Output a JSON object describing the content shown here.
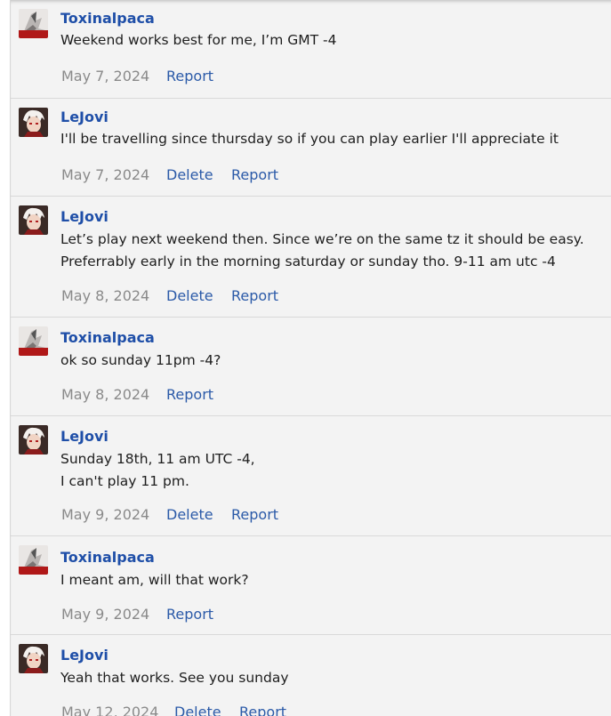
{
  "messages": [
    {
      "author": "Toxinalpaca",
      "avatar": "toxinalpaca-avatar",
      "lines": [
        "Weekend works best for me, I’m GMT -4"
      ],
      "date": "May 7, 2024",
      "actions": [
        "Report"
      ]
    },
    {
      "author": "LeJovi",
      "avatar": "lejovi-avatar",
      "lines": [
        "I'll be travelling since thursday so if you can play earlier I'll appreciate it"
      ],
      "date": "May 7, 2024",
      "actions": [
        "Delete",
        "Report"
      ]
    },
    {
      "author": "LeJovi",
      "avatar": "lejovi-avatar",
      "lines": [
        "Let’s play next weekend then. Since we’re on the same tz it should be easy.",
        "Preferrably early in the morning saturday or sunday tho. 9-11 am utc -4"
      ],
      "date": "May 8, 2024",
      "actions": [
        "Delete",
        "Report"
      ]
    },
    {
      "author": "Toxinalpaca",
      "avatar": "toxinalpaca-avatar",
      "lines": [
        "ok so sunday 11pm -4?"
      ],
      "date": "May 8, 2024",
      "actions": [
        "Report"
      ]
    },
    {
      "author": "LeJovi",
      "avatar": "lejovi-avatar",
      "lines": [
        "Sunday 18th, 11 am UTC -4,",
        "I can't play 11 pm."
      ],
      "date": "May 9, 2024",
      "actions": [
        "Delete",
        "Report"
      ]
    },
    {
      "author": "Toxinalpaca",
      "avatar": "toxinalpaca-avatar",
      "lines": [
        "I meant am, will that work?"
      ],
      "date": "May 9, 2024",
      "actions": [
        "Report"
      ]
    },
    {
      "author": "LeJovi",
      "avatar": "lejovi-avatar",
      "lines": [
        "Yeah that works. See you sunday"
      ],
      "date": "May 12, 2024",
      "actions": [
        "Delete",
        "Report"
      ]
    }
  ]
}
